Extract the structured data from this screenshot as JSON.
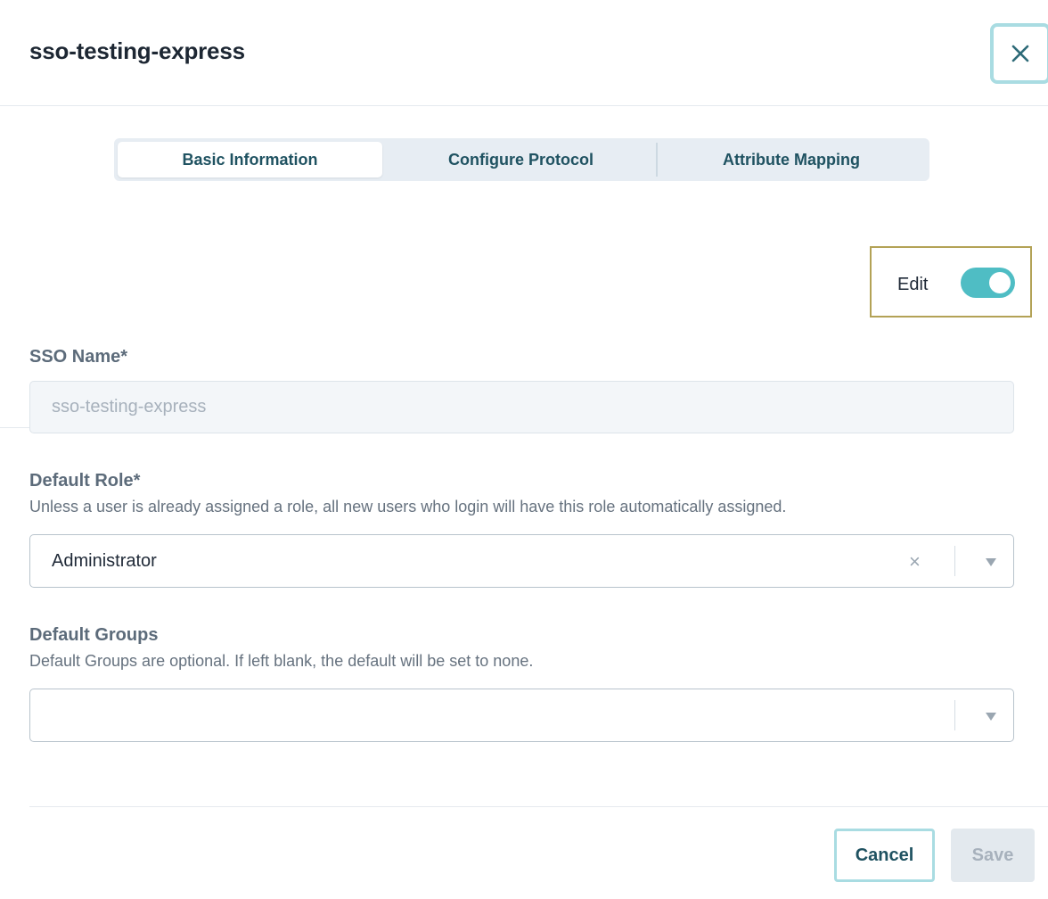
{
  "dialog": {
    "title": "sso-testing-express",
    "close_icon": "close-icon"
  },
  "tabs": [
    {
      "label": "Basic Information",
      "active": true
    },
    {
      "label": "Configure Protocol",
      "active": false
    },
    {
      "label": "Attribute Mapping",
      "active": false
    }
  ],
  "edit_toggle": {
    "label": "Edit",
    "on": true
  },
  "sso_name": {
    "label": "SSO Name*",
    "value": "sso-testing-express",
    "disabled": true
  },
  "default_role": {
    "label": "Default Role*",
    "help": "Unless a user is already assigned a role, all new users who login will have this role automatically assigned.",
    "value": "Administrator",
    "clear_icon": "×"
  },
  "default_groups": {
    "label": "Default Groups",
    "help": "Default Groups are optional. If left blank, the default will be set to none.",
    "value": ""
  },
  "footer": {
    "cancel_label": "Cancel",
    "save_label": "Save"
  },
  "colors": {
    "accent": "#4fbdc4",
    "tab_text": "#1f5261",
    "highlight_border": "#b3a256"
  }
}
